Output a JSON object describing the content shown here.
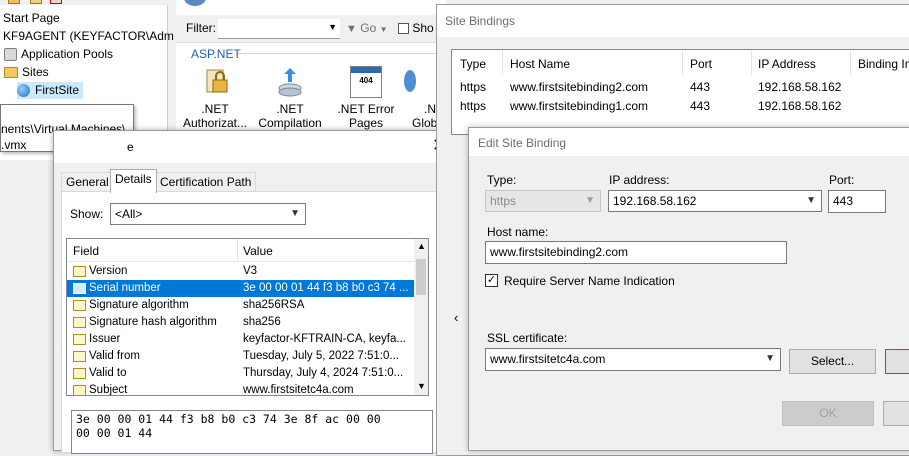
{
  "tree": {
    "items": [
      "Start Page",
      "KF9AGENT (KEYFACTOR\\Adm",
      "Application Pools",
      "Sites",
      "FirstSite"
    ]
  },
  "iis": {
    "filter_label": "Filter:",
    "go_label": "Go",
    "show_label": "Sho",
    "group_label": "ASP.NET",
    "features": [
      {
        "line1": ".NET",
        "line2": "Authorizat..."
      },
      {
        "line1": ".NET",
        "line2": "Compilation"
      },
      {
        "line1": ".NET Error",
        "line2": "Pages",
        "badge": "404"
      },
      {
        "line1": ".N",
        "line2": "Globa"
      }
    ]
  },
  "tooltip": {
    "line1": "nents\\Virtual Machines\\",
    "line2": ".vmx"
  },
  "cert": {
    "title_fragment": "e",
    "tabs": [
      "General",
      "Details",
      "Certification Path"
    ],
    "show_label": "Show:",
    "show_value": "<All>",
    "col_field": "Field",
    "col_value": "Value",
    "rows": [
      {
        "field": "Version",
        "value": "V3"
      },
      {
        "field": "Serial number",
        "value": "3e 00 00 01 44 f3 b8 b0 c3 74 ..."
      },
      {
        "field": "Signature algorithm",
        "value": "sha256RSA"
      },
      {
        "field": "Signature hash algorithm",
        "value": "sha256"
      },
      {
        "field": "Issuer",
        "value": "keyfactor-KFTRAIN-CA, keyfa..."
      },
      {
        "field": "Valid from",
        "value": "Tuesday, July 5, 2022 7:51:0..."
      },
      {
        "field": "Valid to",
        "value": "Thursday, July 4, 2024 7:51:0..."
      },
      {
        "field": "Subject",
        "value": "www.firstsitetc4a.com"
      }
    ],
    "value_line1": "3e 00 00 01 44 f3 b8 b0 c3 74 3e 8f ac 00 00",
    "value_line2": "00 00 01 44"
  },
  "site_bindings": {
    "title": "Site Bindings",
    "columns": [
      "Type",
      "Host Name",
      "Port",
      "IP Address",
      "Binding In"
    ],
    "rows": [
      {
        "type": "https",
        "host": "www.firstsitebinding2.com",
        "port": "443",
        "ip": "192.168.58.162"
      },
      {
        "type": "https",
        "host": "www.firstsitebinding1.com",
        "port": "443",
        "ip": "192.168.58.162"
      }
    ]
  },
  "edit_binding": {
    "title": "Edit Site Binding",
    "type_label": "Type:",
    "type_value": "https",
    "ip_label": "IP address:",
    "ip_value": "192.168.58.162",
    "port_label": "Port:",
    "port_value": "443",
    "host_label": "Host name:",
    "host_value": "www.firstsitebinding2.com",
    "sni_label": "Require Server Name Indication",
    "sni_checked": true,
    "ssl_label": "SSL certificate:",
    "ssl_value": "www.firstsitetc4a.com",
    "select_label": "Select...",
    "ok_label": "OK"
  }
}
